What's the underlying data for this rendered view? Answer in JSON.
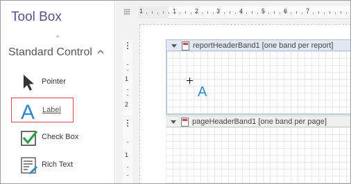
{
  "toolbox": {
    "title": "Tool Box",
    "group_label": "Standard Control",
    "items": [
      {
        "label": "Pointer",
        "icon": "pointer-arrow-icon"
      },
      {
        "label": "Label",
        "icon": "label-a-icon",
        "selected": true
      },
      {
        "label": "Check Box",
        "icon": "checkbox-icon"
      },
      {
        "label": "Rich Text",
        "icon": "rich-text-icon"
      }
    ]
  },
  "ruler": {
    "top_numbers": [
      "1",
      "1",
      "2",
      "3",
      "4",
      "5",
      "6",
      "7"
    ],
    "left_numbers_band1": [
      "1",
      "2"
    ],
    "left_numbers_band2": [
      "1"
    ]
  },
  "bands": [
    {
      "caption": "reportHeaderBand1 [one band per report]"
    },
    {
      "caption": "pageHeaderBand1 [one band per page]"
    }
  ],
  "canvas": {
    "label_glyph": "A"
  },
  "colors": {
    "title": "#5b4e8a",
    "accent_blue": "#2f86c8",
    "selection_red": "#e0454f",
    "band_selected": "#dfe8f3"
  }
}
